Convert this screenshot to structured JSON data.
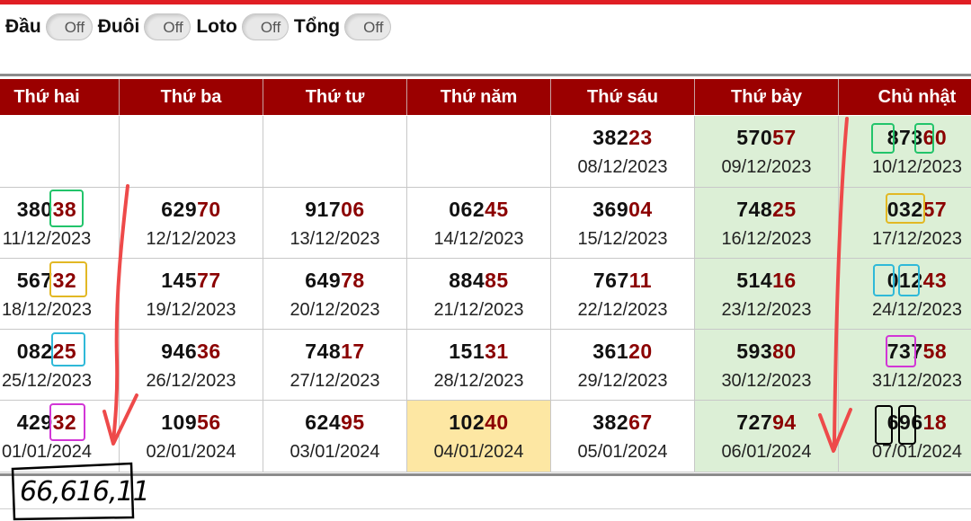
{
  "filters": [
    {
      "label": "Đầu",
      "state": "Off"
    },
    {
      "label": "Đuôi",
      "state": "Off"
    },
    {
      "label": "Loto",
      "state": "Off"
    },
    {
      "label": "Tổng",
      "state": "Off"
    }
  ],
  "calendar": {
    "headers": [
      "Thứ hai",
      "Thứ ba",
      "Thứ tư",
      "Thứ năm",
      "Thứ sáu",
      "Thứ bảy",
      "Chủ nhật"
    ],
    "rows": [
      [
        null,
        null,
        null,
        null,
        {
          "head": "382",
          "tail": "23",
          "date": "08/12/2023"
        },
        {
          "head": "570",
          "tail": "57",
          "date": "09/12/2023"
        },
        {
          "head": "873",
          "tail": "60",
          "date": "10/12/2023"
        }
      ],
      [
        {
          "head": "380",
          "tail": "38",
          "date": "11/12/2023"
        },
        {
          "head": "629",
          "tail": "70",
          "date": "12/12/2023"
        },
        {
          "head": "917",
          "tail": "06",
          "date": "13/12/2023"
        },
        {
          "head": "062",
          "tail": "45",
          "date": "14/12/2023"
        },
        {
          "head": "369",
          "tail": "04",
          "date": "15/12/2023"
        },
        {
          "head": "748",
          "tail": "25",
          "date": "16/12/2023"
        },
        {
          "head": "032",
          "tail": "57",
          "date": "17/12/2023"
        }
      ],
      [
        {
          "head": "567",
          "tail": "32",
          "date": "18/12/2023"
        },
        {
          "head": "145",
          "tail": "77",
          "date": "19/12/2023"
        },
        {
          "head": "649",
          "tail": "78",
          "date": "20/12/2023"
        },
        {
          "head": "884",
          "tail": "85",
          "date": "21/12/2023"
        },
        {
          "head": "767",
          "tail": "11",
          "date": "22/12/2023"
        },
        {
          "head": "514",
          "tail": "16",
          "date": "23/12/2023"
        },
        {
          "head": "012",
          "tail": "43",
          "date": "24/12/2023"
        }
      ],
      [
        {
          "head": "082",
          "tail": "25",
          "date": "25/12/2023"
        },
        {
          "head": "946",
          "tail": "36",
          "date": "26/12/2023"
        },
        {
          "head": "748",
          "tail": "17",
          "date": "27/12/2023"
        },
        {
          "head": "151",
          "tail": "31",
          "date": "28/12/2023"
        },
        {
          "head": "361",
          "tail": "20",
          "date": "29/12/2023"
        },
        {
          "head": "593",
          "tail": "80",
          "date": "30/12/2023"
        },
        {
          "head": "737",
          "tail": "58",
          "date": "31/12/2023"
        }
      ],
      [
        {
          "head": "429",
          "tail": "32",
          "date": "01/01/2024"
        },
        {
          "head": "109",
          "tail": "56",
          "date": "02/01/2024"
        },
        {
          "head": "624",
          "tail": "95",
          "date": "03/01/2024"
        },
        {
          "head": "102",
          "tail": "40",
          "date": "04/01/2024",
          "highlight": true
        },
        {
          "head": "382",
          "tail": "67",
          "date": "05/01/2024"
        },
        {
          "head": "727",
          "tail": "94",
          "date": "06/01/2024"
        },
        {
          "head": "696",
          "tail": "18",
          "date": "07/01/2024"
        }
      ]
    ]
  },
  "handwritten_note": "66,616,11",
  "colors": {
    "header_bg": "#9b0000",
    "tail_digits": "#8b0000",
    "weekend_bg": "#dcefd6",
    "today_bg": "#fde7a3",
    "accent_bar": "#e01e24"
  }
}
